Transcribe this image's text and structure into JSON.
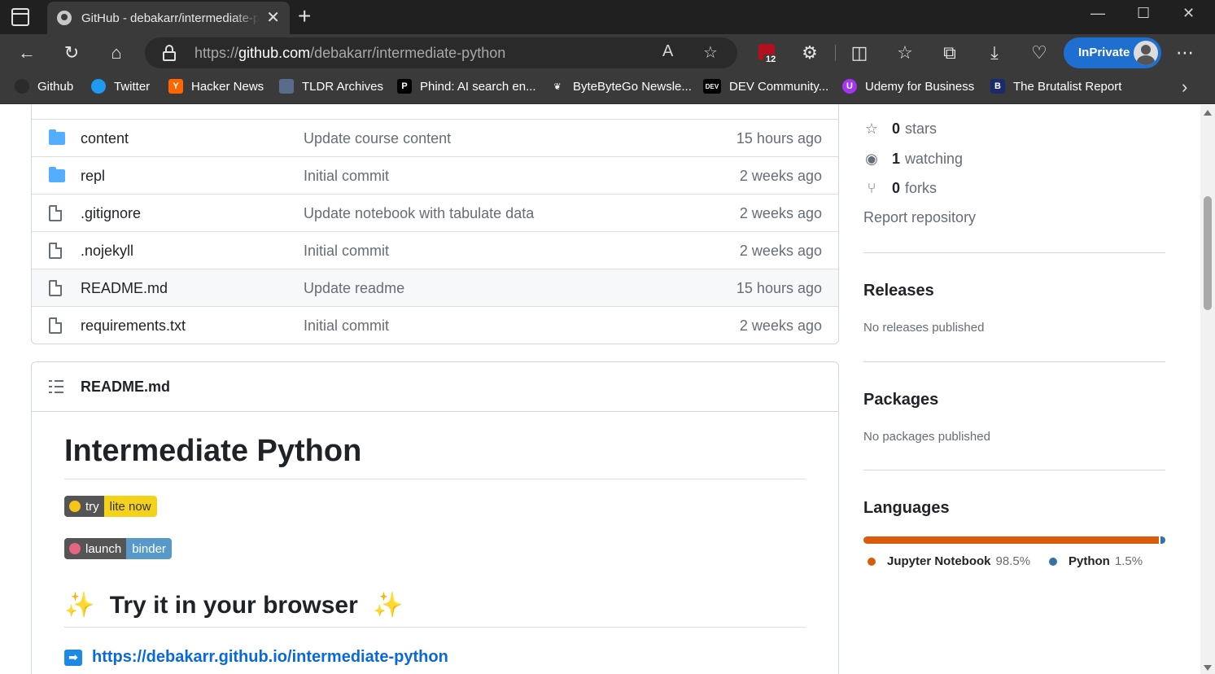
{
  "browser": {
    "tab_title": "GitHub - debakarr/intermediate-python",
    "url_scheme": "https://",
    "url_host": "github.com",
    "url_path": "/debakarr/intermediate-python",
    "extension_badge_count": "12",
    "inprivate_label": "InPrivate"
  },
  "bookmarks": [
    {
      "label": "Github",
      "icon": "github-icon",
      "color": "#2b2b2b"
    },
    {
      "label": "Twitter",
      "icon": "twitter-icon",
      "color": "#1d9bf0"
    },
    {
      "label": "Hacker News",
      "icon": "hacker-news-icon",
      "color": "#ff6600",
      "glyph": "Y"
    },
    {
      "label": "TLDR Archives",
      "icon": "tldr-icon",
      "color": "#5a6b8c"
    },
    {
      "label": "Phind: AI search en...",
      "icon": "phind-icon",
      "color": "#000000",
      "glyph": "P"
    },
    {
      "label": "ByteByteGo Newsle...",
      "icon": "bytebytego-icon",
      "color": "#3a3a3a"
    },
    {
      "label": "DEV Community...",
      "icon": "dev-icon",
      "color": "#000000",
      "glyph": "DEV"
    },
    {
      "label": "Udemy for Business",
      "icon": "udemy-icon",
      "color": "#a435f0",
      "glyph": "U"
    },
    {
      "label": "The Brutalist Report",
      "icon": "brutalist-icon",
      "color": "#1a2a6c",
      "glyph": "B"
    }
  ],
  "files": [
    {
      "name": "content",
      "type": "folder",
      "message": "Update course content",
      "age": "15 hours ago"
    },
    {
      "name": "repl",
      "type": "folder",
      "message": "Initial commit",
      "age": "2 weeks ago"
    },
    {
      "name": ".gitignore",
      "type": "file",
      "message": "Update notebook with tabulate data",
      "age": "2 weeks ago"
    },
    {
      "name": ".nojekyll",
      "type": "file",
      "message": "Initial commit",
      "age": "2 weeks ago"
    },
    {
      "name": "README.md",
      "type": "file",
      "message": "Update readme",
      "age": "15 hours ago"
    },
    {
      "name": "requirements.txt",
      "type": "file",
      "message": "Initial commit",
      "age": "2 weeks ago"
    }
  ],
  "readme": {
    "header": "README.md",
    "h1": "Intermediate Python",
    "badge1_left": "try",
    "badge1_right": "lite now",
    "badge2_left": "launch",
    "badge2_right": "binder",
    "h2": "Try it in your browser",
    "sparkle": "✨",
    "link": "https://debakarr.github.io/intermediate-python",
    "arrow": "➡"
  },
  "sidebar": {
    "stars_count": "0",
    "stars_label": "stars",
    "watching_count": "1",
    "watching_label": "watching",
    "forks_count": "0",
    "forks_label": "forks",
    "report": "Report repository",
    "releases_title": "Releases",
    "releases_note": "No releases published",
    "packages_title": "Packages",
    "packages_note": "No packages published",
    "languages_title": "Languages",
    "languages": [
      {
        "name": "Jupyter Notebook",
        "percent": "98.5%",
        "share": 98.5,
        "color": "#DA5B0B"
      },
      {
        "name": "Python",
        "percent": "1.5%",
        "share": 1.5,
        "color": "#3572A5"
      }
    ]
  }
}
